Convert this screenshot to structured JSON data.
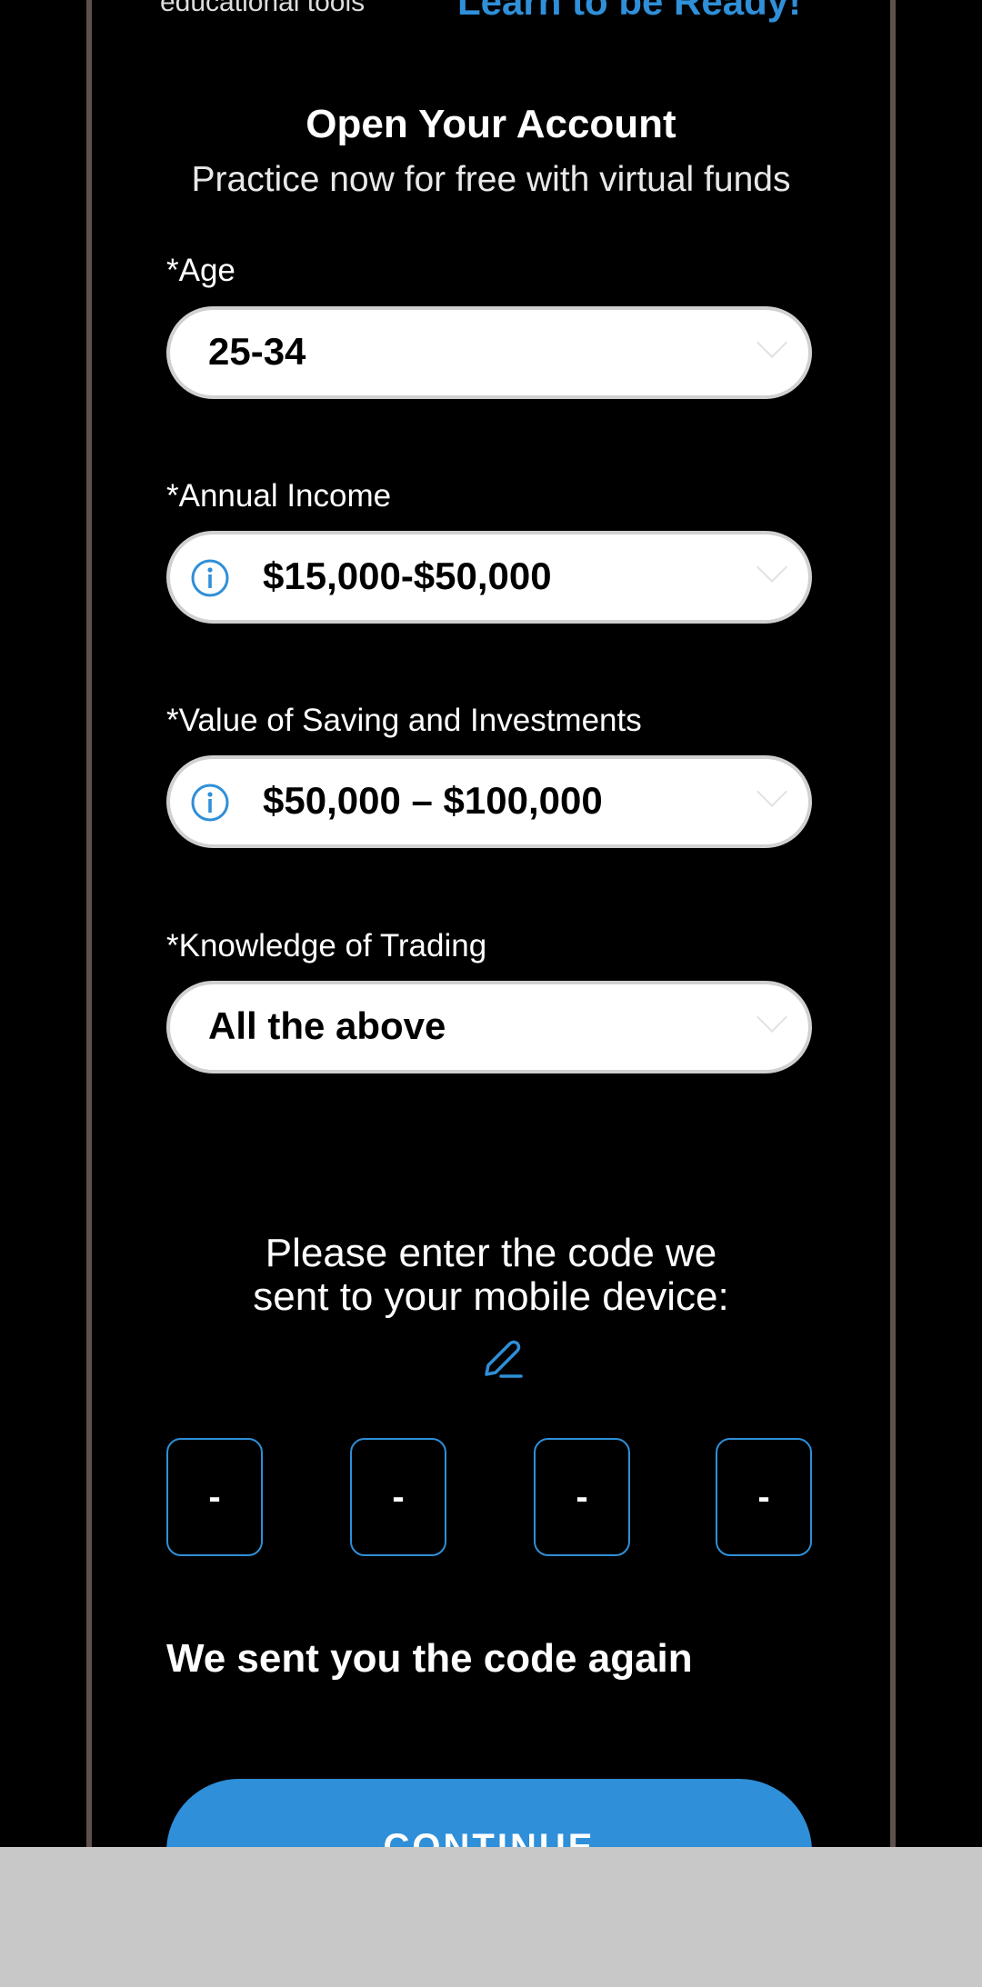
{
  "top_strip": {
    "edu_text": "educational tools",
    "learn_text": "Learn to be Ready!"
  },
  "form": {
    "title": "Open Your Account",
    "subtitle": "Practice now for free with virtual funds",
    "fields": [
      {
        "label": "*Age",
        "value": "25-34",
        "has_info": false
      },
      {
        "label": "*Annual Income",
        "value": "$15,000-$50,000",
        "has_info": true
      },
      {
        "label": "*Value of Saving and Investments",
        "value": "$50,000 – $100,000",
        "has_info": true
      },
      {
        "label": "*Knowledge of Trading",
        "value": "All the above",
        "has_info": false
      }
    ]
  },
  "verification": {
    "prompt": "Please enter the code we sent to your mobile device:",
    "digits": [
      "-",
      "-",
      "-",
      "-"
    ],
    "resent_message": "We sent you the code again"
  },
  "continue_label": "CONTINUE",
  "colors": {
    "accent": "#2f8fd8",
    "background": "#000000",
    "bottom_bar": "#c8c8c8",
    "frame_border": "#5e504b"
  },
  "icons": {
    "info": "info-icon",
    "edit": "pencil-icon",
    "dropdown": "chevron-down-icon"
  }
}
